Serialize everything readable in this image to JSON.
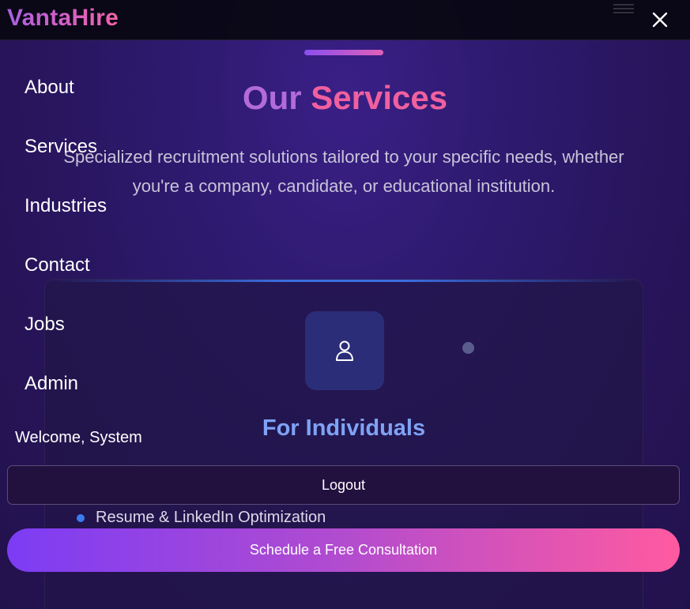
{
  "header": {
    "logo": "VantaHire",
    "close_icon": "close-icon"
  },
  "section": {
    "title_part1": "Our",
    "title_part2": "Services",
    "subtitle": "Specialized recruitment solutions tailored to your specific needs, whether you're a company, candidate, or educational institution.",
    "card": {
      "icon": "user-icon",
      "title": "For Individuals",
      "features": [
        "Resume & LinkedIn Optimization"
      ]
    }
  },
  "menu": {
    "items": [
      {
        "label": "About"
      },
      {
        "label": "Services"
      },
      {
        "label": "Industries"
      },
      {
        "label": "Contact"
      },
      {
        "label": "Jobs"
      },
      {
        "label": "Admin"
      }
    ],
    "welcome": "Welcome, System",
    "logout_label": "Logout",
    "cta_label": "Schedule a Free Consultation"
  },
  "colors": {
    "brand_gradient_start": "#7c3cf4",
    "brand_gradient_end": "#ff5aa0",
    "card_title": "#7fa3f5",
    "bullet": "#3a7df0"
  }
}
